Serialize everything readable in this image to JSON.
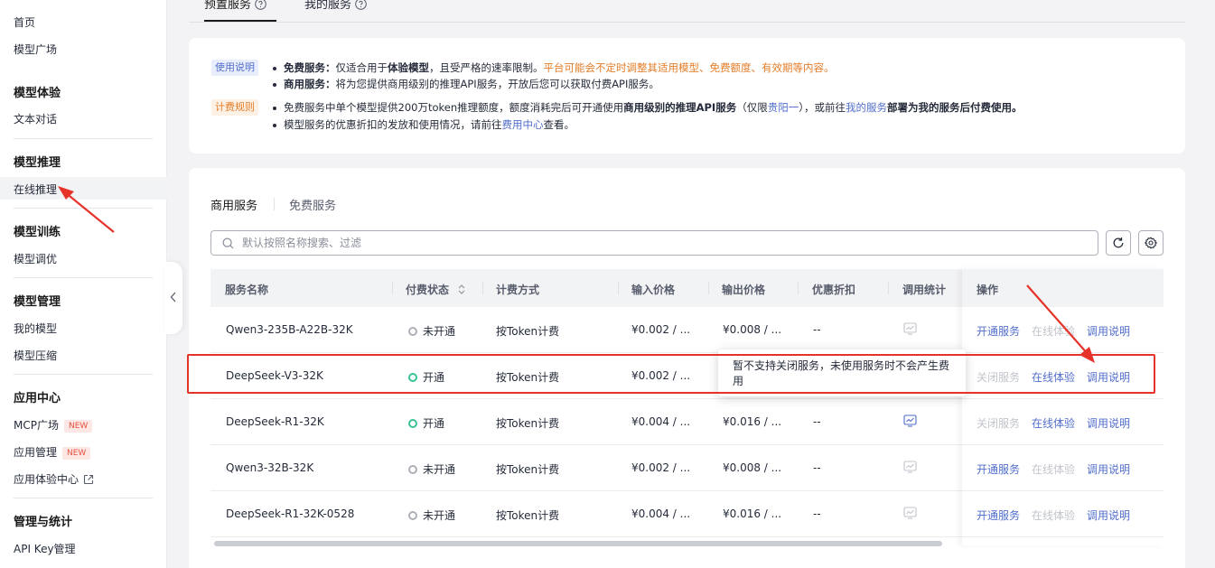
{
  "sidebar": {
    "items": [
      {
        "label": "首页"
      },
      {
        "label": "模型广场"
      }
    ],
    "groups": [
      {
        "title": "模型体验",
        "items": [
          "文本对话"
        ]
      },
      {
        "title": "模型推理",
        "items": [
          "在线推理"
        ]
      },
      {
        "title": "模型训练",
        "items": [
          "模型调优"
        ]
      },
      {
        "title": "模型管理",
        "items": [
          "我的模型",
          "模型压缩"
        ]
      },
      {
        "title": "应用中心",
        "items": [
          "MCP广场",
          "应用管理",
          "应用体验中心"
        ]
      },
      {
        "title": "管理与统计",
        "items": [
          "API Key管理"
        ]
      }
    ],
    "new_badge": "NEW"
  },
  "top_tabs": [
    {
      "label": "预置服务",
      "active": true
    },
    {
      "label": "我的服务",
      "active": false
    }
  ],
  "notice": {
    "usage_tag": "使用说明",
    "billing_tag": "计费规则",
    "lines": {
      "l1_a": "免费服务：",
      "l1_b": "仅适合用于",
      "l1_c": "体验模型",
      "l1_d": "，且受严格的速率限制。",
      "l1_e": "平台可能会不定时调整其适用模型、免费额度、有效期等内容。",
      "l2_a": "商用服务：",
      "l2_b": "将为您提供商用级别的推理API服务，开放后您可以获取付费API服务。",
      "l3_a": "免费服务中单个模型提供200万token推理额度，额度消耗完后可开通使用",
      "l3_b": "商用级别的推理API服务",
      "l3_c": "（仅限",
      "l3_d": "贵阳一",
      "l3_e": "），或前往",
      "l3_f": "我的服务",
      "l3_g": "部署为我的服务后付费使用。",
      "l4_a": "模型服务的优惠折扣的发放和使用情况，请前往",
      "l4_b": "费用中心",
      "l4_c": "查看。"
    }
  },
  "service_tabs": [
    {
      "label": "商用服务",
      "active": true
    },
    {
      "label": "免费服务",
      "active": false
    }
  ],
  "search": {
    "placeholder": "默认按照名称搜索、过滤"
  },
  "table": {
    "headers": {
      "name": "服务名称",
      "status": "付费状态",
      "billing": "计费方式",
      "input_price": "输入价格",
      "output_price": "输出价格",
      "discount": "优惠折扣",
      "stats": "调用统计",
      "ops": "操作"
    },
    "rows": [
      {
        "name": "Qwen3-235B-A22B-32K",
        "status": "未开通",
        "active": false,
        "billing": "按Token计费",
        "input": "¥0.002 / ...",
        "output": "¥0.008 / ...",
        "discount": "--",
        "op1": "开通服务",
        "op2": "在线体验",
        "op3": "调用说明"
      },
      {
        "name": "DeepSeek-V3-32K",
        "status": "开通",
        "active": true,
        "billing": "按Token计费",
        "input": "¥0.002 / ...",
        "output": "",
        "discount": "",
        "op1": "关闭服务",
        "op2": "在线体验",
        "op3": "调用说明"
      },
      {
        "name": "DeepSeek-R1-32K",
        "status": "开通",
        "active": true,
        "billing": "按Token计费",
        "input": "¥0.004 / ...",
        "output": "¥0.016 / ...",
        "discount": "--",
        "op1": "关闭服务",
        "op2": "在线体验",
        "op3": "调用说明"
      },
      {
        "name": "Qwen3-32B-32K",
        "status": "未开通",
        "active": false,
        "billing": "按Token计费",
        "input": "¥0.002 / ...",
        "output": "¥0.008 / ...",
        "discount": "--",
        "op1": "开通服务",
        "op2": "在线体验",
        "op3": "调用说明"
      },
      {
        "name": "DeepSeek-R1-32K-0528",
        "status": "未开通",
        "active": false,
        "billing": "按Token计费",
        "input": "¥0.004 / ...",
        "output": "¥0.016 / ...",
        "discount": "--",
        "op1": "开通服务",
        "op2": "在线体验",
        "op3": "调用说明"
      }
    ]
  },
  "tooltip": {
    "text": "暂不支持关闭服务，未使用服务时不会产生费用"
  },
  "colors": {
    "accent": "#526ecc",
    "active_status": "#3ac295",
    "annotation": "#e6332a",
    "warning": "#e37d29"
  }
}
